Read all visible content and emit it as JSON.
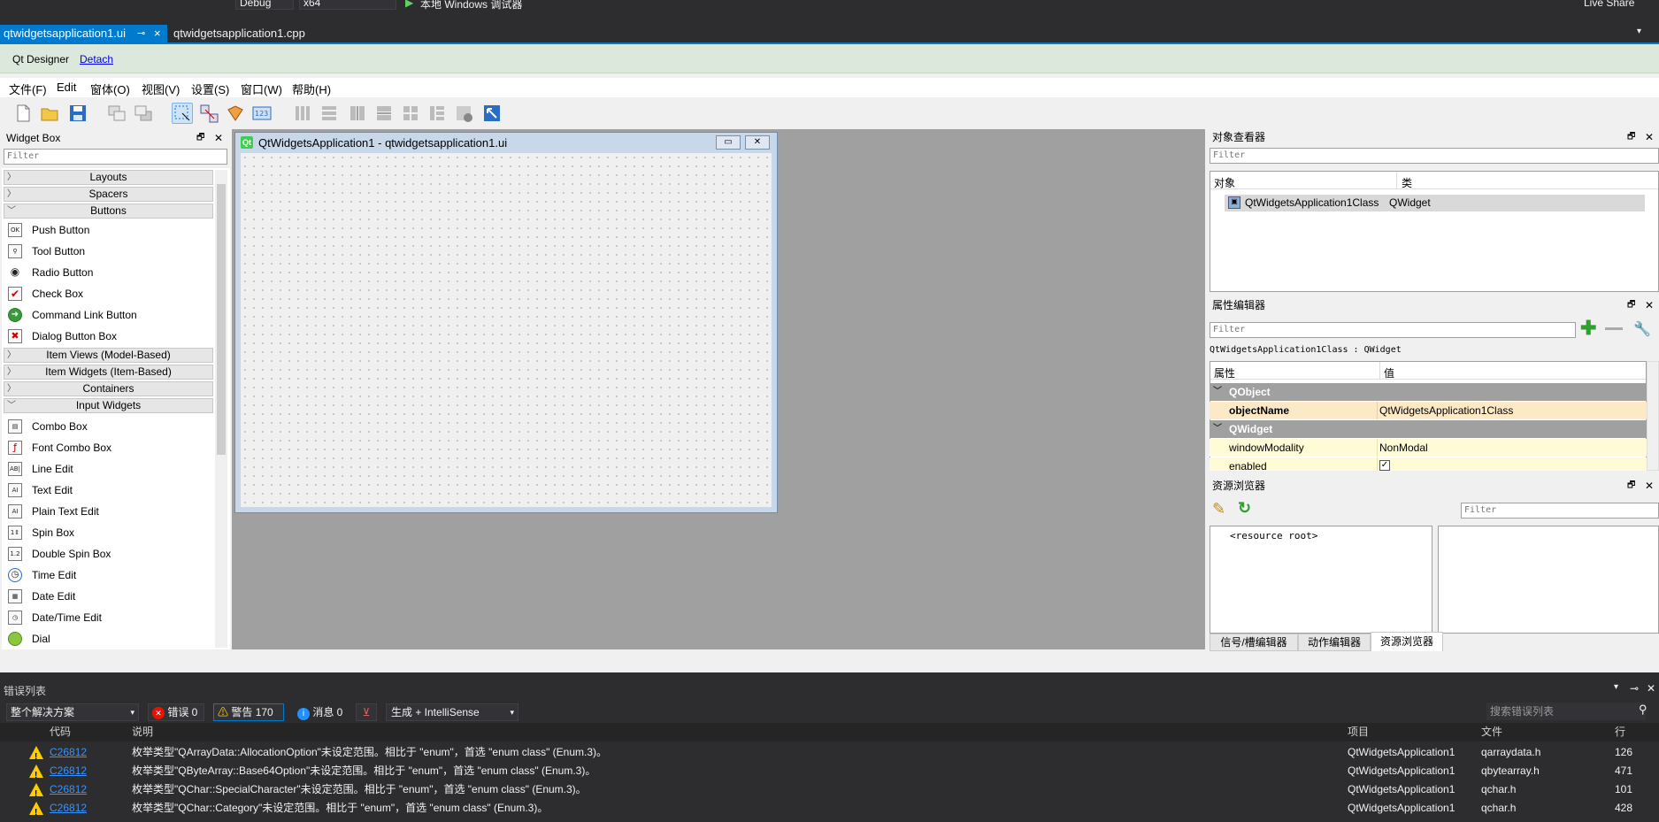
{
  "vs": {
    "config": "Debug",
    "platform": "x64",
    "run_target": "本地 Windows 调试器",
    "live_share": "Live Share"
  },
  "doc_tabs": {
    "active": "qtwidgetsapplication1.ui",
    "active_pin": "⊸",
    "active_close": "×",
    "inactive": "qtwidgetsapplication1.cpp"
  },
  "qt_bar": {
    "title": "Qt Designer",
    "detach": "Detach"
  },
  "menu": [
    "文件(F)",
    "Edit",
    "窗体(O)",
    "视图(V)",
    "设置(S)",
    "窗口(W)",
    "帮助(H)"
  ],
  "widget_box": {
    "title": "Widget Box",
    "filter_placeholder": "Filter",
    "categories": {
      "layouts": "Layouts",
      "spacers": "Spacers",
      "buttons": "Buttons",
      "item_views": "Item Views (Model-Based)",
      "item_widgets": "Item Widgets (Item-Based)",
      "containers": "Containers",
      "input_widgets": "Input Widgets"
    },
    "buttons": [
      "Push Button",
      "Tool Button",
      "Radio Button",
      "Check Box",
      "Command Link Button",
      "Dialog Button Box"
    ],
    "inputs": [
      "Combo Box",
      "Font Combo Box",
      "Line Edit",
      "Text Edit",
      "Plain Text Edit",
      "Spin Box",
      "Double Spin Box",
      "Time Edit",
      "Date Edit",
      "Date/Time Edit",
      "Dial"
    ]
  },
  "form": {
    "title": "QtWidgetsApplication1 - qtwidgetsapplication1.ui"
  },
  "object_inspector": {
    "title": "对象查看器",
    "filter_placeholder": "Filter",
    "col_object": "对象",
    "col_class": "类",
    "row_object": "QtWidgetsApplication1Class",
    "row_class": "QWidget"
  },
  "property_editor": {
    "title": "属性编辑器",
    "filter_placeholder": "Filter",
    "context": "QtWidgetsApplication1Class : QWidget",
    "col_property": "属性",
    "col_value": "值",
    "group_qobject": "QObject",
    "object_name_key": "objectName",
    "object_name_value": "QtWidgetsApplication1Class",
    "group_qwidget": "QWidget",
    "modality_key": "windowModality",
    "modality_value": "NonModal",
    "enabled_key": "enabled",
    "enabled_value": true
  },
  "resource_browser": {
    "title": "资源浏览器",
    "filter_placeholder": "Filter",
    "root": "<resource root>"
  },
  "bottom_tabs": [
    "信号/槽编辑器",
    "动作编辑器",
    "资源浏览器"
  ],
  "error_list": {
    "title": "错误列表",
    "scope": "整个解决方案",
    "errors": "错误 0",
    "warnings": "警告 170",
    "messages": "消息 0",
    "build_filter": "生成 + IntelliSense",
    "search_placeholder": "搜索错误列表",
    "headers": {
      "code": "代码",
      "desc": "说明",
      "project": "项目",
      "file": "文件",
      "line": "行"
    },
    "rows": [
      {
        "code": "C26812",
        "desc": "枚举类型\"QArrayData::AllocationOption\"未设定范围。相比于 \"enum\"，首选 \"enum class\" (Enum.3)。",
        "project": "QtWidgetsApplication1",
        "file": "qarraydata.h",
        "line": "126"
      },
      {
        "code": "C26812",
        "desc": "枚举类型\"QByteArray::Base64Option\"未设定范围。相比于 \"enum\"，首选 \"enum class\" (Enum.3)。",
        "project": "QtWidgetsApplication1",
        "file": "qbytearray.h",
        "line": "471"
      },
      {
        "code": "C26812",
        "desc": "枚举类型\"QChar::SpecialCharacter\"未设定范围。相比于 \"enum\"，首选 \"enum class\" (Enum.3)。",
        "project": "QtWidgetsApplication1",
        "file": "qchar.h",
        "line": "101"
      },
      {
        "code": "C26812",
        "desc": "枚举类型\"QChar::Category\"未设定范围。相比于 \"enum\"，首选 \"enum class\" (Enum.3)。",
        "project": "QtWidgetsApplication1",
        "file": "qchar.h",
        "line": "428"
      }
    ]
  },
  "colors": {
    "vs_accent": "#007acc",
    "warning": "#ffcc00",
    "link": "#3794ff",
    "property_group": "#a0a0a0",
    "property_row": "#fffbe0"
  }
}
